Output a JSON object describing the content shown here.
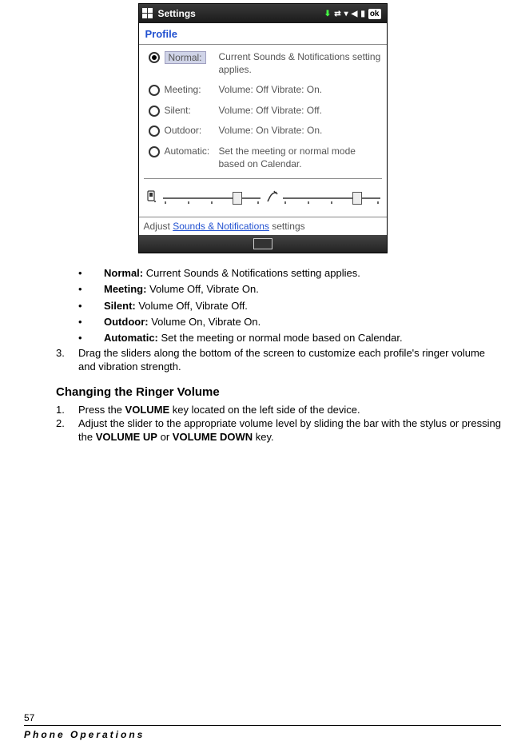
{
  "screenshot": {
    "title": "Settings",
    "ok": "ok",
    "section": "Profile",
    "rows": [
      {
        "label": "Normal:",
        "desc": "Current Sounds & Notifications setting applies.",
        "selected": true
      },
      {
        "label": "Meeting:",
        "desc": "Volume: Off Vibrate: On.",
        "selected": false
      },
      {
        "label": "Silent:",
        "desc": "Volume: Off Vibrate: Off.",
        "selected": false
      },
      {
        "label": "Outdoor:",
        "desc": "Volume: On Vibrate: On.",
        "selected": false
      },
      {
        "label": "Automatic:",
        "desc": "Set the meeting or normal mode based on Calendar.",
        "selected": false
      }
    ],
    "adjust_prefix": "Adjust ",
    "adjust_link": "Sounds & Notifications",
    "adjust_suffix": " settings"
  },
  "bullets": [
    {
      "term": "Normal:",
      "desc": " Current Sounds & Notifications setting applies."
    },
    {
      "term": "Meeting:",
      "desc": " Volume Off, Vibrate On."
    },
    {
      "term": "Silent:",
      "desc": " Volume Off, Vibrate Off."
    },
    {
      "term": "Outdoor:",
      "desc": " Volume On, Vibrate On."
    },
    {
      "term": "Automatic:",
      "desc": " Set the meeting or normal mode based on Calendar."
    }
  ],
  "step3": {
    "num": "3.",
    "text": "Drag the sliders along the bottom of the screen to customize each profile's ringer volume and vibration strength."
  },
  "section_title": "Changing the Ringer Volume",
  "steps": [
    {
      "num": "1.",
      "pre": "Press the ",
      "b1": "VOLUME",
      "post": " key located on the left side of the device."
    },
    {
      "num": "2.",
      "pre": "Adjust the slider to the appropriate volume level by sliding the bar with the stylus or pressing the ",
      "b1": "VOLUME UP",
      "mid": " or ",
      "b2": "VOLUME DOWN",
      "post": " key."
    }
  ],
  "footer": {
    "page": "57",
    "title": "Phone Operations"
  }
}
